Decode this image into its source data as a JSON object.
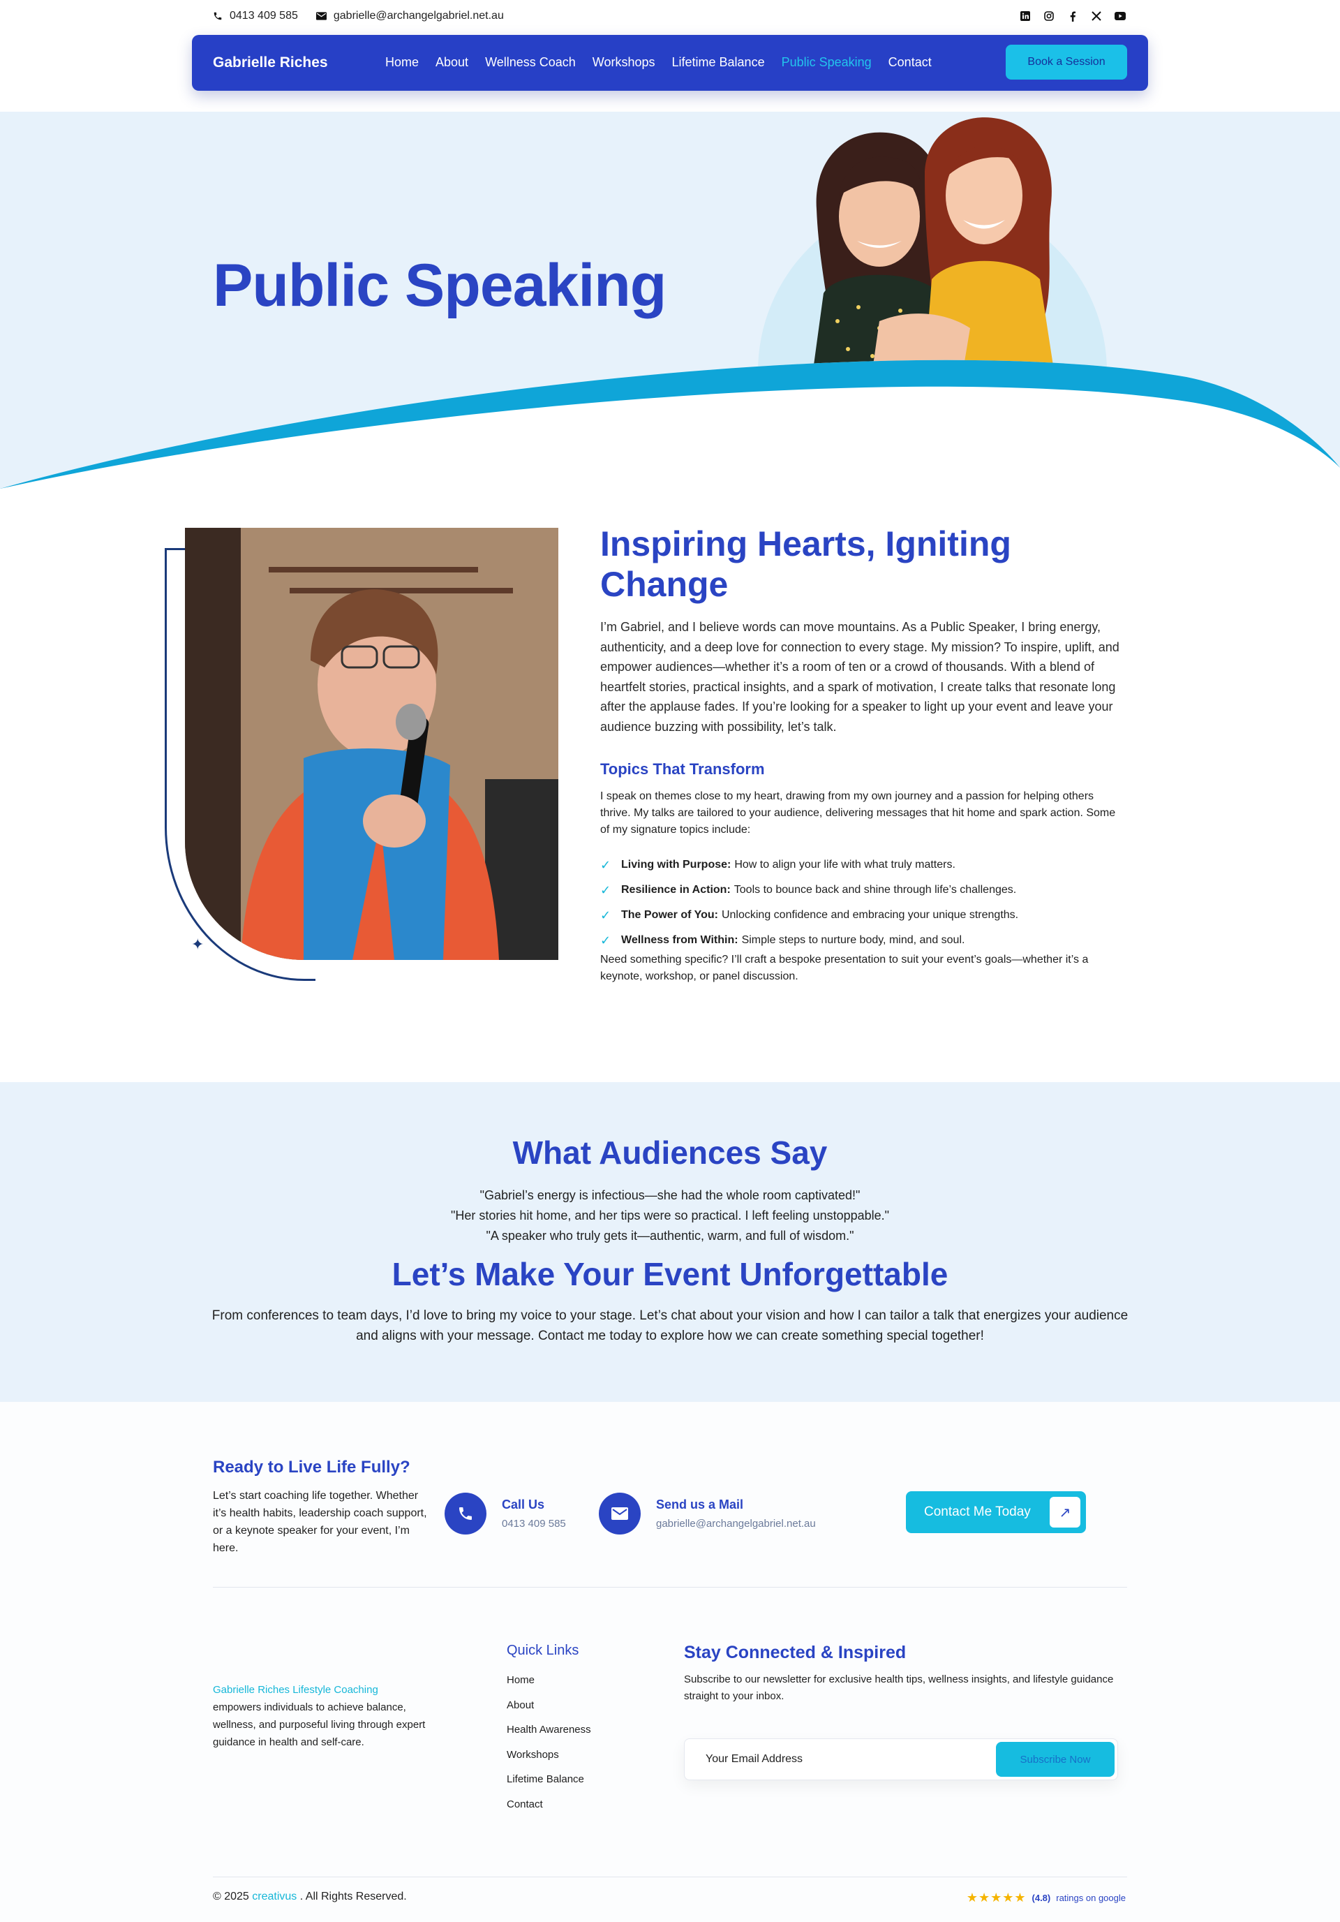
{
  "topbar": {
    "phone": "0413 409 585",
    "email": "gabrielle@archangelgabriel.net.au",
    "social": [
      "linkedin-icon",
      "instagram-icon",
      "facebook-icon",
      "x-icon",
      "youtube-icon"
    ]
  },
  "nav": {
    "brand": "Gabrielle Riches",
    "items": [
      "Home",
      "About",
      "Wellness Coach",
      "Workshops",
      "Lifetime Balance",
      "Public Speaking",
      "Contact"
    ],
    "active": "Public Speaking",
    "cta": "Book a Session"
  },
  "hero": {
    "title": "Public Speaking"
  },
  "about": {
    "heading": "Inspiring Hearts, Igniting Change",
    "intro": "I’m Gabriel, and I believe words can move mountains. As a Public Speaker, I bring energy, authenticity, and a deep love for connection to every stage. My mission? To inspire, uplift, and empower audiences—whether it’s a room of ten or a crowd of thousands. With a blend of heartfelt stories, practical insights, and a spark of motivation, I create talks that resonate long after the applause fades. If you’re looking for a speaker to light up your event and leave your audience buzzing with possibility, let’s talk.",
    "topics_heading": "Topics That Transform",
    "topics_intro": "I speak on themes close to my heart, drawing from my own journey and a passion for helping others thrive. My talks are tailored to your audience, delivering messages that hit home and spark action. Some of my signature topics include:",
    "topics": [
      {
        "title": "Living with Purpose:",
        "text": "How to align your life with what truly matters."
      },
      {
        "title": "Resilience in Action:",
        "text": "Tools to bounce back and shine through life’s challenges."
      },
      {
        "title": "The Power of You:",
        "text": "Unlocking confidence and embracing your unique strengths."
      },
      {
        "title": "Wellness from Within:",
        "text": "Simple steps to nurture body, mind, and soul."
      }
    ],
    "closing": "Need something specific? I’ll craft a bespoke presentation to suit your event’s goals—whether it’s a keynote, workshop, or panel discussion."
  },
  "testimonials": {
    "heading": "What Audiences Say",
    "quotes": [
      "\"Gabriel’s energy is infectious—she had the whole room captivated!\"",
      "\"Her stories hit home, and her tips were so practical. I left feeling unstoppable.\"",
      "\"A speaker who truly gets it—authentic, warm, and full of wisdom.\""
    ],
    "cta_heading": "Let’s Make Your Event Unforgettable",
    "cta_text": "From conferences to team days, I’d love to bring my voice to your stage. Let’s chat about your vision and how I can tailor a talk that energizes your audience and aligns with your message. Contact me today to explore how we can create something special together!"
  },
  "footer": {
    "ready_heading": "Ready to Live Life Fully?",
    "ready_text": "Let’s start coaching life together. Whether it’s health habits, leadership coach support, or a keynote speaker for your event, I’m here.",
    "call_label": "Call Us",
    "call_value": "0413 409 585",
    "mail_label": "Send us a Mail",
    "mail_value": "gabrielle@archangelgabriel.net.au",
    "contact_button": "Contact Me Today",
    "brand_highlight": "Gabrielle Riches Lifestyle Coaching",
    "brand_text": "empowers individuals to achieve balance, wellness, and purposeful living through expert guidance in health and self-care.",
    "quick_heading": "Quick Links",
    "quick_links": [
      "Home",
      "About",
      "Health Awareness",
      "Workshops",
      "Lifetime Balance",
      "Contact"
    ],
    "newsletter_heading": "Stay Connected & Inspired",
    "newsletter_text": "Subscribe to our newsletter for exclusive health tips, wellness insights, and lifestyle guidance straight to your inbox.",
    "email_placeholder": "Your Email Address",
    "subscribe": "Subscribe Now",
    "copyright_prefix": "© 2025",
    "copyright_brand": "creativus",
    "copyright_suffix": ". All Rights Reserved.",
    "rating_score": "(4.8)",
    "rating_text": "ratings on google",
    "rating_value": 4.8
  },
  "colors": {
    "primary": "#2a44c3",
    "accent": "#16bce0",
    "hero_bg": "#e7f2fb"
  }
}
